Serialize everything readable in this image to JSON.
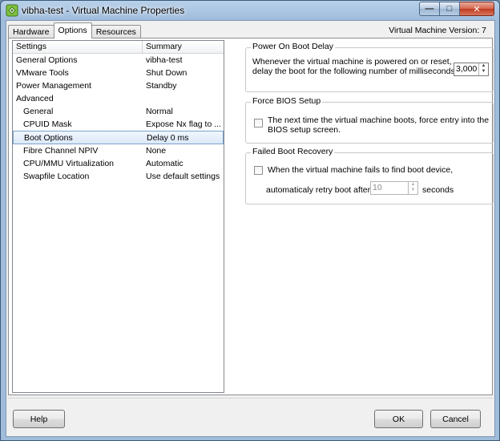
{
  "window": {
    "title": "vibha-test - Virtual Machine Properties",
    "version_text": "Virtual Machine Version: 7",
    "controls": {
      "minimize": "—",
      "maximize": "□",
      "close": "✕"
    }
  },
  "tabs": [
    {
      "label": "Hardware",
      "active": false
    },
    {
      "label": "Options",
      "active": true
    },
    {
      "label": "Resources",
      "active": false
    }
  ],
  "settings_list": {
    "headers": {
      "settings": "Settings",
      "summary": "Summary"
    },
    "rows": [
      {
        "name": "General Options",
        "summary": "vibha-test"
      },
      {
        "name": "VMware Tools",
        "summary": "Shut Down"
      },
      {
        "name": "Power Management",
        "summary": "Standby"
      },
      {
        "name": "Advanced",
        "summary": ""
      },
      {
        "name": "General",
        "summary": "Normal"
      },
      {
        "name": "CPUID Mask",
        "summary": "Expose Nx flag to ..."
      },
      {
        "name": "Boot Options",
        "summary": "Delay 0 ms",
        "selected": true
      },
      {
        "name": "Fibre Channel NPIV",
        "summary": "None"
      },
      {
        "name": "CPU/MMU Virtualization",
        "summary": "Automatic"
      },
      {
        "name": "Swapfile Location",
        "summary": "Use default settings"
      }
    ]
  },
  "power_on_boot_delay": {
    "title": "Power On Boot Delay",
    "line1": "Whenever the virtual machine is powered on or reset,",
    "line2": "delay the boot for the following number of milliseconds:",
    "value": "3,000"
  },
  "force_bios_setup": {
    "title": "Force BIOS Setup",
    "line1": "The next time the virtual machine boots, force entry into the",
    "line2": "BIOS setup screen.",
    "checked": false
  },
  "failed_boot_recovery": {
    "title": "Failed Boot Recovery",
    "line1": "When the virtual machine fails to find boot device,",
    "line2_prefix": "automaticaly retry boot after",
    "retry_value": "10",
    "line2_suffix": "seconds",
    "checked": false
  },
  "buttons": {
    "help": "Help",
    "ok": "OK",
    "cancel": "Cancel"
  },
  "colors": {
    "selection": "#dce9f8",
    "title_bar": "#b9d1ea",
    "close_button": "#c0391f"
  }
}
